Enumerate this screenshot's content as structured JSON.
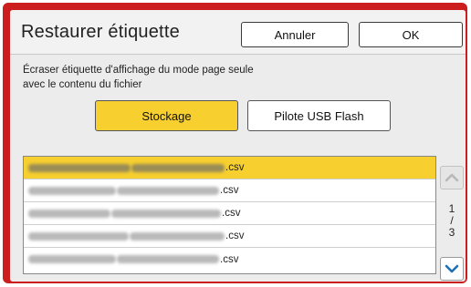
{
  "dialog": {
    "title": "Restaurer étiquette",
    "cancel_label": "Annuler",
    "ok_label": "OK"
  },
  "instruction": {
    "line1": "Écraser étiquette d'affichage du mode page seule",
    "line2": "avec le contenu du fichier"
  },
  "source": {
    "storage_label": "Stockage",
    "usb_label": "Pilote USB Flash",
    "selected": "Stockage"
  },
  "files": [
    {
      "suffix": ".csv",
      "selected": true
    },
    {
      "suffix": ".csv",
      "selected": false
    },
    {
      "suffix": ".csv",
      "selected": false
    },
    {
      "suffix": ".csv",
      "selected": false
    },
    {
      "suffix": ".csv",
      "selected": false
    }
  ],
  "pagination": {
    "current": "1",
    "separator": "/",
    "total": "3"
  },
  "icons": {
    "scroll_up": "chevron-up-icon",
    "scroll_down": "chevron-down-icon"
  },
  "colors": {
    "frame": "#cc1e1e",
    "accent": "#f7cf2e",
    "scroll_active": "#1f6fb5",
    "scroll_disabled": "#b8b8b8"
  }
}
